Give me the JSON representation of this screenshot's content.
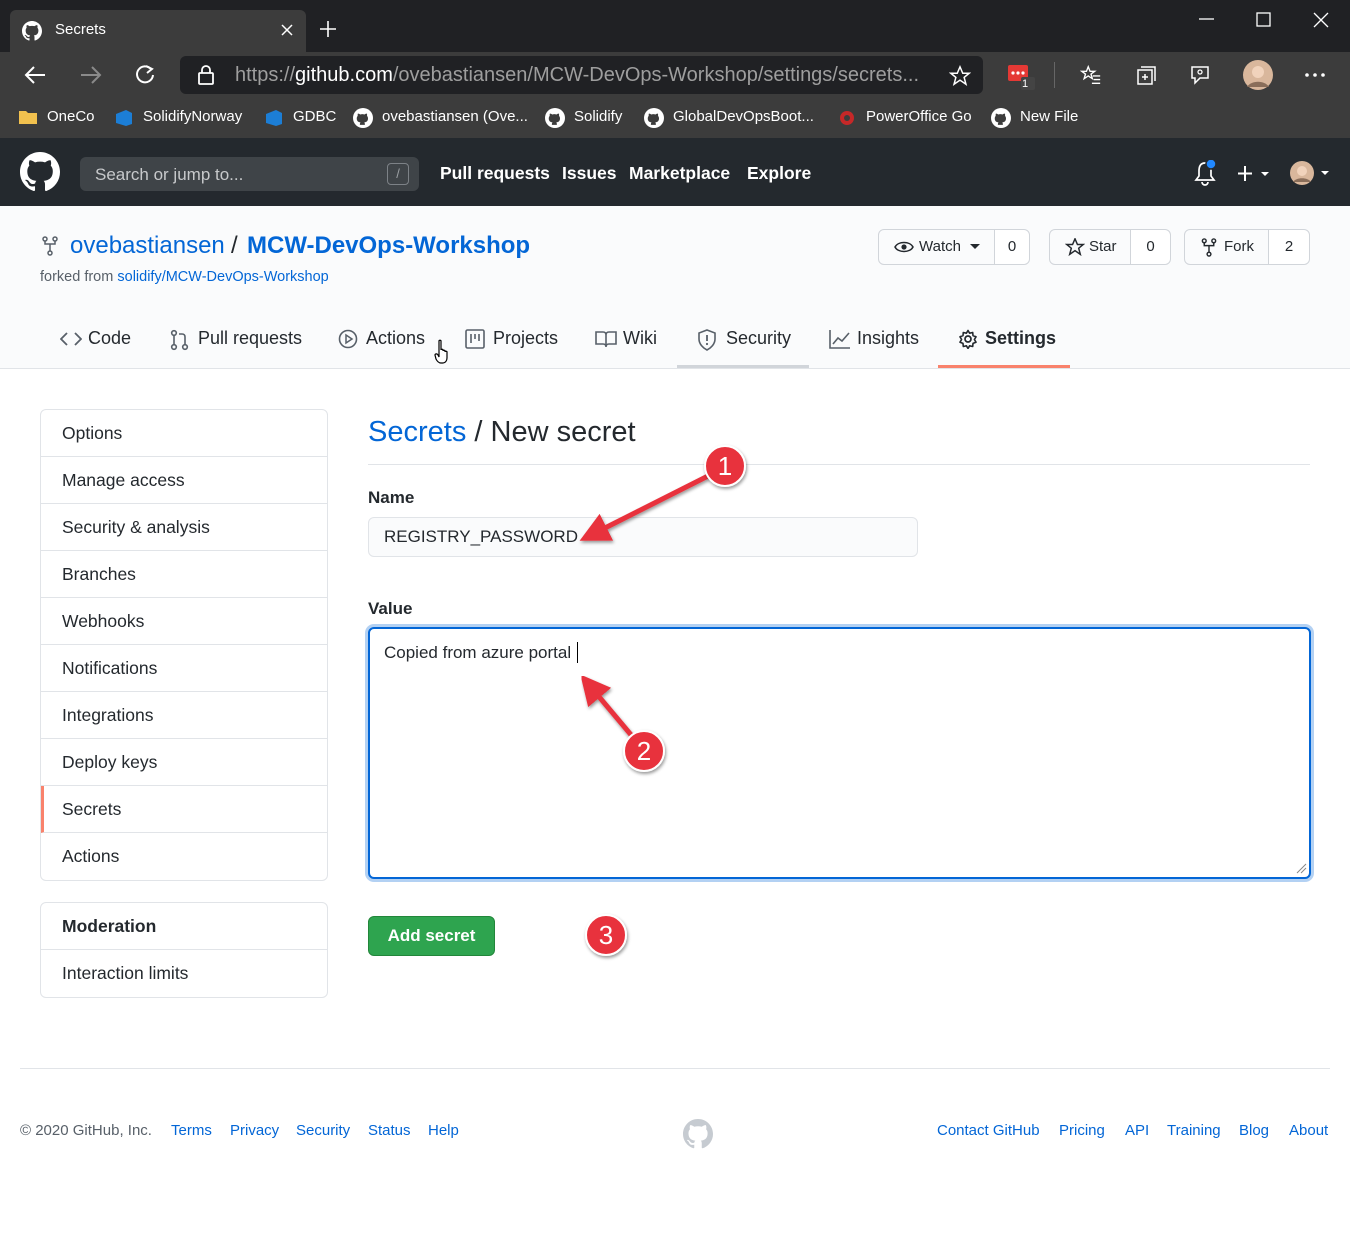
{
  "browser": {
    "tab_title": "Secrets",
    "url_prefix": "https://",
    "url_host": "github.com",
    "url_path": "/ovebastiansen/MCW-DevOps-Workshop/settings/secrets...",
    "ext_badge": "1",
    "bookmarks": [
      "OneCo",
      "SolidifyNorway",
      "GDBC",
      "ovebastiansen (Ove...",
      "Solidify",
      "GlobalDevOpsBoot...",
      "PowerOffice Go",
      "New File"
    ]
  },
  "gh_header": {
    "search_placeholder": "Search or jump to...",
    "search_shortcut": "/",
    "nav": [
      "Pull requests",
      "Issues",
      "Marketplace",
      "Explore"
    ]
  },
  "repo": {
    "owner": "ovebastiansen",
    "separator": "/",
    "name": "MCW-DevOps-Workshop",
    "forked_label": "forked from",
    "forked_from": "solidify/MCW-DevOps-Workshop",
    "watch_label": "Watch",
    "watch_count": "0",
    "star_label": "Star",
    "star_count": "0",
    "fork_label": "Fork",
    "fork_count": "2",
    "tabs": [
      "Code",
      "Pull requests",
      "Actions",
      "Projects",
      "Wiki",
      "Security",
      "Insights",
      "Settings"
    ]
  },
  "sidebar": {
    "items": [
      "Options",
      "Manage access",
      "Security & analysis",
      "Branches",
      "Webhooks",
      "Notifications",
      "Integrations",
      "Deploy keys",
      "Secrets",
      "Actions"
    ],
    "selected": "Secrets",
    "moderation_title": "Moderation",
    "moderation_items": [
      "Interaction limits"
    ]
  },
  "form": {
    "breadcrumb_link": "Secrets",
    "breadcrumb_sep": "/",
    "title": "New secret",
    "name_label": "Name",
    "name_value": "REGISTRY_PASSWORD",
    "value_label": "Value",
    "value_value": "Copied from azure portal",
    "submit_label": "Add secret"
  },
  "annotations": [
    "1",
    "2",
    "3"
  ],
  "footer": {
    "copyright": "© 2020 GitHub, Inc.",
    "left_links": [
      "Terms",
      "Privacy",
      "Security",
      "Status",
      "Help"
    ],
    "right_links": [
      "Contact GitHub",
      "Pricing",
      "API",
      "Training",
      "Blog",
      "About"
    ]
  },
  "colors": {
    "link": "#0366d6",
    "primary_button": "#2ea44f",
    "selected_accent": "#f9826c",
    "annotation_red": "#e8323c"
  }
}
